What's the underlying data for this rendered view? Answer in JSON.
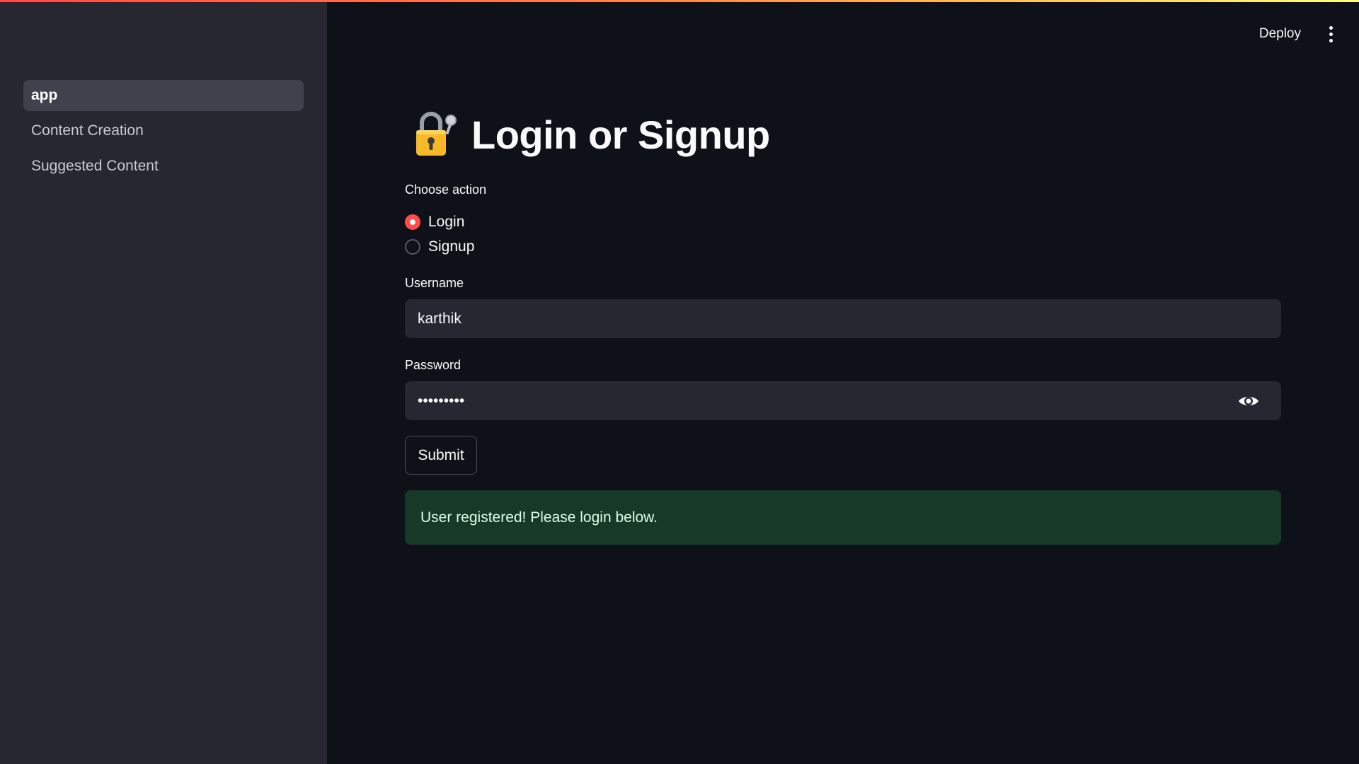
{
  "sidebar": {
    "items": [
      {
        "label": "app",
        "active": true
      },
      {
        "label": "Content Creation",
        "active": false
      },
      {
        "label": "Suggested Content",
        "active": false
      }
    ]
  },
  "header": {
    "deploy_label": "Deploy",
    "menu_icon": "vertical-dots-icon"
  },
  "main": {
    "title_icon": "lock-with-key-icon",
    "title": "Login or Signup",
    "action": {
      "label": "Choose action",
      "options": [
        {
          "label": "Login",
          "checked": true
        },
        {
          "label": "Signup",
          "checked": false
        }
      ]
    },
    "username": {
      "label": "Username",
      "value": "karthik"
    },
    "password": {
      "label": "Password",
      "value": "•••••••••",
      "toggle_icon": "eye-icon"
    },
    "submit_label": "Submit",
    "alert_text": "User registered! Please login below."
  },
  "colors": {
    "accent": "#ff4b4b",
    "background": "#0e1117",
    "sidebar": "#262730",
    "success_bg": "#173928"
  }
}
